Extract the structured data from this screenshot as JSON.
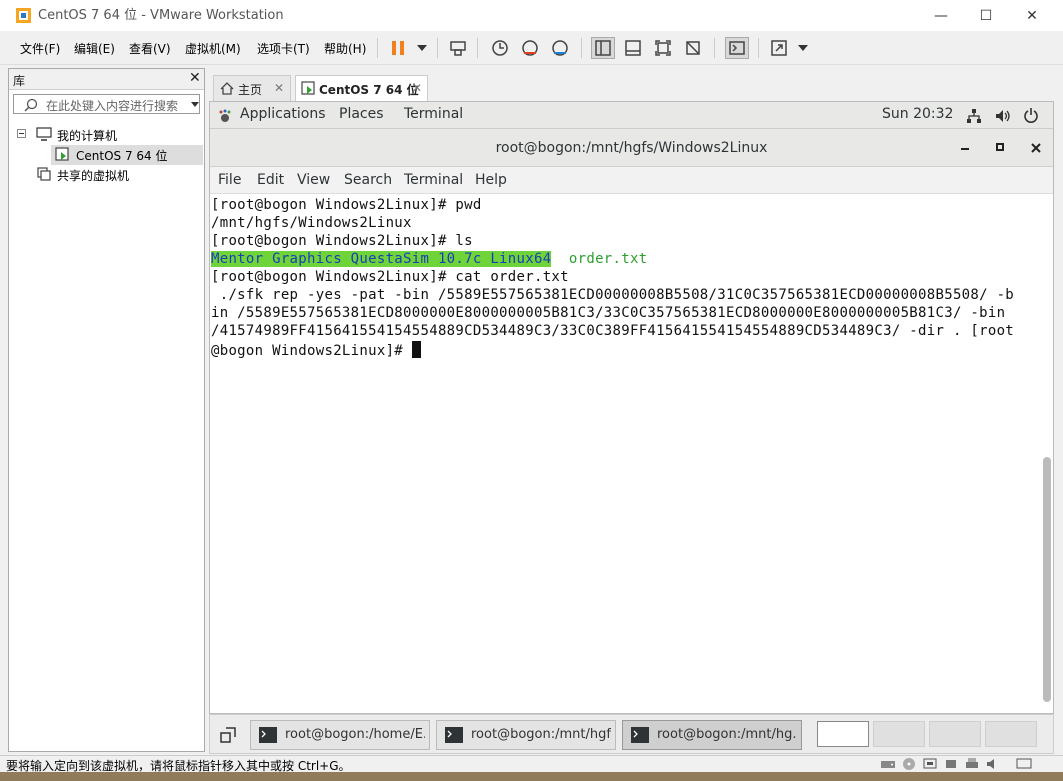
{
  "window": {
    "title": "CentOS 7 64 位 - VMware Workstation",
    "minimize": "—",
    "maximize": "☐",
    "close": "✕"
  },
  "menu": {
    "items": [
      "文件(F)",
      "编辑(E)",
      "查看(V)",
      "虚拟机(M)",
      "选项卡(T)",
      "帮助(H)"
    ]
  },
  "library": {
    "title": "库",
    "close": "✕",
    "search_placeholder": "在此处键入内容进行搜索",
    "tree": {
      "my_computer": "我的计算机",
      "vm": "CentOS 7 64 位",
      "shared": "共享的虚拟机"
    }
  },
  "tabs": {
    "home": "主页",
    "vm": "CentOS 7 64 位",
    "close": "✕"
  },
  "gnome": {
    "applications": "Applications",
    "places": "Places",
    "terminal": "Terminal",
    "clock": "Sun 20:32"
  },
  "terminal": {
    "title": "root@bogon:/mnt/hgfs/Windows2Linux",
    "menu": [
      "File",
      "Edit",
      "View",
      "Search",
      "Terminal",
      "Help"
    ],
    "lines": {
      "l1": "[root@bogon Windows2Linux]# pwd",
      "l2": "/mnt/hgfs/Windows2Linux",
      "l3": "[root@bogon Windows2Linux]# ls",
      "l4_dir": "Mentor Graphics QuestaSim 10.7c Linux64",
      "l4_file": "order.txt",
      "l5": "[root@bogon Windows2Linux]# cat order.txt",
      "l6": " ./sfk rep -yes -pat -bin /5589E557565381ECD00000008B5508/31C0C357565381ECD00000008B5508/ -b",
      "l7": "in /5589E557565381ECD8000000E8000000005B81C3/33C0C357565381ECD8000000E8000000005B81C3/ -bin",
      "l8": "/41574989FF415641554154554889CD534489C3/33C0C389FF415641554154554889CD534489C3/ -dir . [root",
      "l9": "@bogon Windows2Linux]# "
    }
  },
  "taskbar": {
    "items": [
      "root@bogon:/home/E...",
      "root@bogon:/mnt/hgf...",
      "root@bogon:/mnt/hg..."
    ]
  },
  "status": {
    "text": "要将输入定向到该虚拟机，请将鼠标指针移入其中或按 Ctrl+G。"
  }
}
